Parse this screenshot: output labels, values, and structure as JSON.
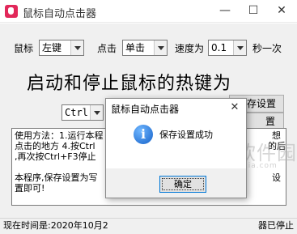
{
  "window": {
    "title": "鼠标自动点击器",
    "controls": {
      "minimize": "—",
      "maximize": "☐",
      "close": "✕"
    }
  },
  "settings": {
    "mouse_label": "鼠标",
    "mouse_button": "左键",
    "click_label": "点击",
    "click_type": "单击",
    "speed_label": "速度为",
    "speed_value": "0.1",
    "speed_unit": "秒一次"
  },
  "hotkey": {
    "headline": "启动和停止鼠标的热键为",
    "modifier": "Ctrl",
    "save_button": "保存设置",
    "second_button": "置"
  },
  "instructions": {
    "line1": "使用方法：1.运行本程",
    "line1_tail": "想",
    "line2": "点击的地方 4.按Ctrl",
    "line2_tail": "的后",
    "line3": ",再次按Ctrl+F3停止",
    "line4": "",
    "line5": "本程序,保存设置为写",
    "line5_tail": "设",
    "line6": "置即可!"
  },
  "status": {
    "left": "现在时间是:2020年10月2",
    "right": "器已停止"
  },
  "watermark": {
    "text": "当下软件园",
    "url": "www.downxia.com"
  },
  "dialog": {
    "title": "鼠标自动点击器",
    "message": "保存设置成功",
    "icon": "information-icon",
    "ok_label": "确定",
    "close": "✕"
  },
  "colors": {
    "app_icon": "#e2285a",
    "info_icon": "#1562c9",
    "focus_border": "#0078d7"
  }
}
